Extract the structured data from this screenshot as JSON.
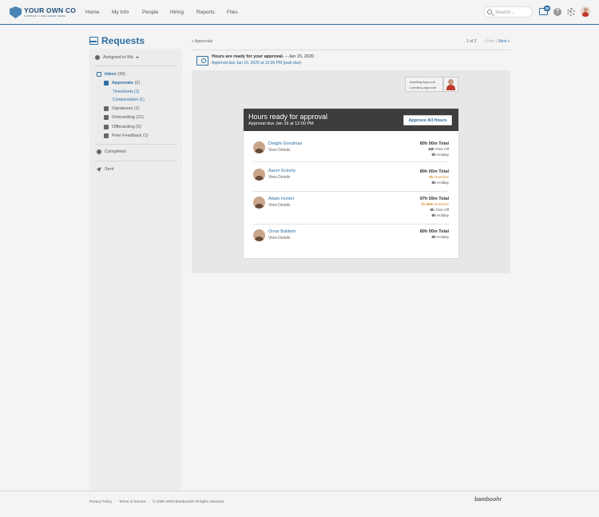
{
  "brand": {
    "name": "YOUR OWN CO",
    "tagline": "COMPANY LOGO GOES HERE"
  },
  "nav": {
    "items": [
      "Home",
      "My Info",
      "People",
      "Hiring",
      "Reports",
      "Files"
    ]
  },
  "search": {
    "placeholder": "Search..."
  },
  "header_badge": "30",
  "help_glyph": "?",
  "page": {
    "title": "Requests"
  },
  "breadcrumb": {
    "back": "« Approvals"
  },
  "pager": {
    "count": "1 of 2",
    "prev": "« Prev",
    "sep": "|",
    "next": "Next »"
  },
  "sidebar": {
    "assigned": "Assigned to Me",
    "inbox_label": "Inbox",
    "inbox_count": "(30)",
    "approvals_label": "Approvals",
    "approvals_count": "(2)",
    "sub_items": [
      "Timesheets (1)",
      "Compensation (1)"
    ],
    "items": [
      "Signatures (1)",
      "Onboarding (21)",
      "Offboarding (5)",
      "Peer Feedback (1)"
    ],
    "completed": "Completed",
    "sent": "Sent"
  },
  "detail": {
    "title": "Hours are ready for your approval.",
    "date": " – Jan 15, 2020",
    "due": "Approval due Jan 16, 2020 at 12:00 PM (past due)."
  },
  "awaiting": {
    "line1": "Awaiting Approval",
    "line2": "1 pending approval"
  },
  "card": {
    "title": "Hours ready for approval",
    "subtitle": "Approval due Jan 16 at 12:00 PM",
    "approve_all": "Approve All Hours"
  },
  "employees": [
    {
      "name": "Dwight Goodman",
      "view": "View Details",
      "total": "80h 00m Total",
      "lines": [
        {
          "v": "16h",
          "t": "Time Off",
          "ot": false
        },
        {
          "v": "8h",
          "t": "Holiday",
          "ot": false
        }
      ]
    },
    {
      "name": "Aaron Eckerly",
      "view": "View Details",
      "total": "80h 00m Total",
      "lines": [
        {
          "v": "0h",
          "t": "Overtime",
          "ot": true
        },
        {
          "v": "8h",
          "t": "Holiday",
          "ot": false
        }
      ]
    },
    {
      "name": "Adam Hunter",
      "view": "View Details",
      "total": "97h 59m Total",
      "lines": [
        {
          "v": "1h 59m",
          "t": "Overtime",
          "ot": true
        },
        {
          "v": "8h",
          "t": "Time Off",
          "ot": false
        },
        {
          "v": "8h",
          "t": "Holiday",
          "ot": false
        }
      ]
    },
    {
      "name": "Omar Baldwin",
      "view": "View Details",
      "total": "80h 00m Total",
      "lines": [
        {
          "v": "8h",
          "t": "Holiday",
          "ot": false
        }
      ]
    }
  ],
  "footer": {
    "privacy": "Privacy Policy",
    "dot": "·",
    "terms": "Terms of Service",
    "copyright": "© 2008–2020 BambooHR All rights reserved.",
    "brand": "bamboohr"
  }
}
